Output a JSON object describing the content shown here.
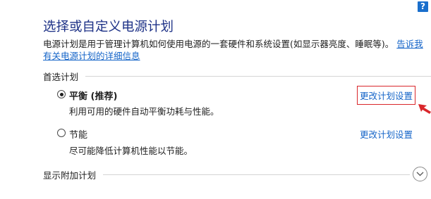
{
  "top_bar": {
    "cut_text_left": "",
    "cut_text_right": "",
    "help_label": "?"
  },
  "page": {
    "title": "选择或自定义电源计划",
    "description": "电源计划是用于管理计算机如何使用电源的一套硬件和系统设置(如显示器亮度、睡眠等)。",
    "learn_more_link": "告诉我有关电源计划的详细信息"
  },
  "preferred_plans": {
    "header": "首选计划",
    "plans": [
      {
        "name": "平衡 (推荐)",
        "description": "利用可用的硬件自动平衡功耗与性能。",
        "selected": true,
        "change_link": "更改计划设置",
        "highlighted": true
      },
      {
        "name": "节能",
        "description": "尽可能降低计算机性能以节能。",
        "selected": false,
        "change_link": "更改计划设置",
        "highlighted": false
      }
    ]
  },
  "additional_plans": {
    "header": "显示附加计划"
  },
  "colors": {
    "title": "#1e3287",
    "link": "#1464c8",
    "highlight": "#d9262b",
    "help_button": "#1a6fcc"
  },
  "icons": {
    "help": "help-icon",
    "annotation_arrow": "arrow-icon",
    "expand": "chevron-down-icon"
  }
}
